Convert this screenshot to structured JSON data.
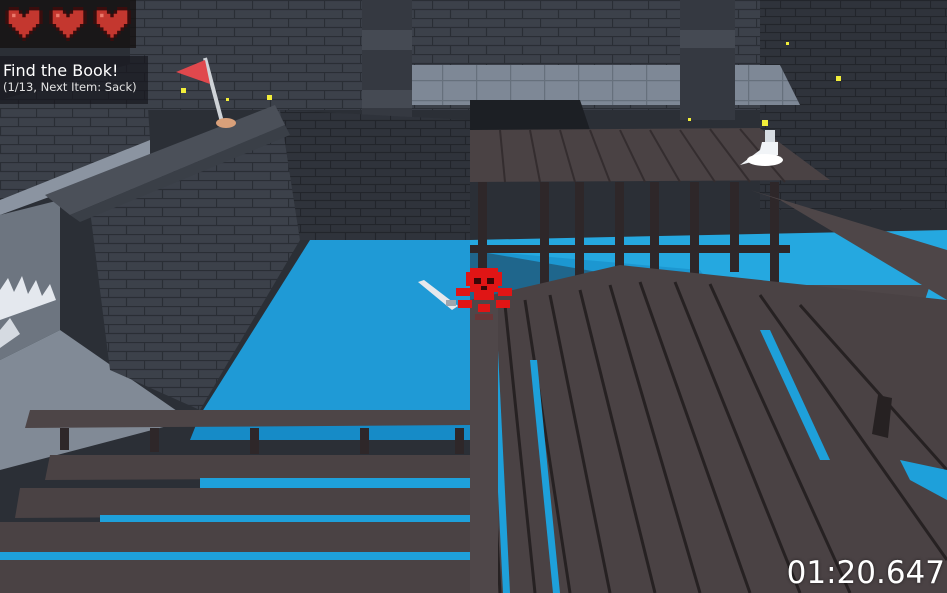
{
  "hud": {
    "health": {
      "current": 3,
      "max": 3
    },
    "quest": {
      "title": "Find the Book!",
      "progress": "(1/13, Next Item: Sack)"
    },
    "timer": "01:20.647"
  },
  "scene": {
    "player_icon": "red-skull-with-sword-icon",
    "objects": [
      "red-flag-icon",
      "potion-flask-icon",
      "spike-trap-icon"
    ]
  },
  "colors": {
    "heart": "#c4372f",
    "heart_outline": "#3a0d0d",
    "water": "#1f9ad6",
    "wood_plank": "#4a4244",
    "stone": "#3e434c",
    "player": "#e01515"
  }
}
